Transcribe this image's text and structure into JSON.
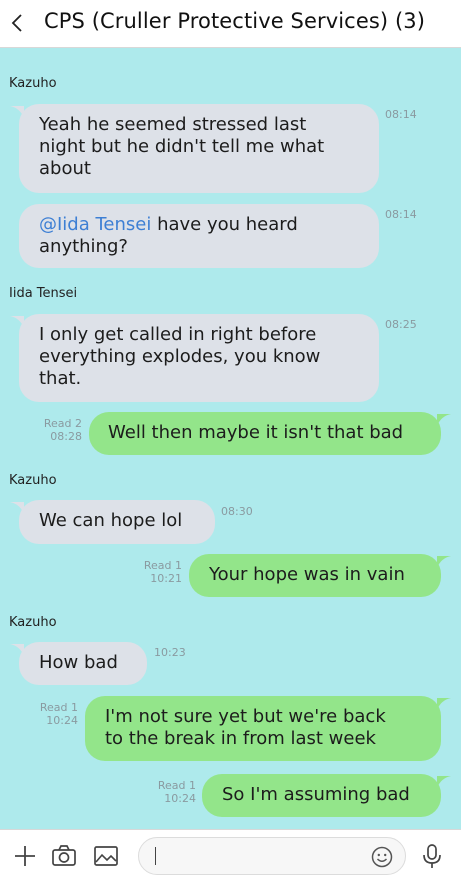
{
  "header": {
    "title": "CPS (Cruller Protective Services) (3)"
  },
  "messages": [
    {
      "sender": "Kazuho",
      "text": [
        "Yeah he seemed stressed last",
        "night but he didn't tell me what",
        "about"
      ],
      "time": "08:14"
    },
    {
      "mention": "@Iida Tensei",
      "text_after_mention": "have you heard",
      "text_line2": "anything?",
      "time": "08:14"
    },
    {
      "sender": "Iida Tensei",
      "text": [
        "I only get called in right before",
        "everything explodes, you know",
        "that."
      ],
      "time": "08:25"
    },
    {
      "text": "Well then maybe it isn't that bad",
      "read": "Read 2",
      "time": "08:28"
    },
    {
      "sender": "Kazuho",
      "text": "We can hope lol",
      "time": "08:30"
    },
    {
      "text": "Your hope was in vain",
      "read": "Read 1",
      "time": "10:21"
    },
    {
      "sender": "Kazuho",
      "text": "How bad",
      "time": "10:23"
    },
    {
      "text": [
        "I'm not sure yet but we're back",
        "to the break in from last week"
      ],
      "read": "Read 1",
      "time": "10:24"
    },
    {
      "text": "So I'm assuming bad",
      "read": "Read 1",
      "time": "10:24"
    }
  ],
  "toolbar": {
    "icons": [
      "plus-icon",
      "camera-icon",
      "image-icon",
      "emoji-icon",
      "microphone-icon"
    ],
    "input_value": ""
  },
  "colors": {
    "chat_background": "#aeeaec",
    "incoming_bubble": "#dde1e8",
    "outgoing_bubble": "#93e58a",
    "mention": "#3d7fd4"
  }
}
